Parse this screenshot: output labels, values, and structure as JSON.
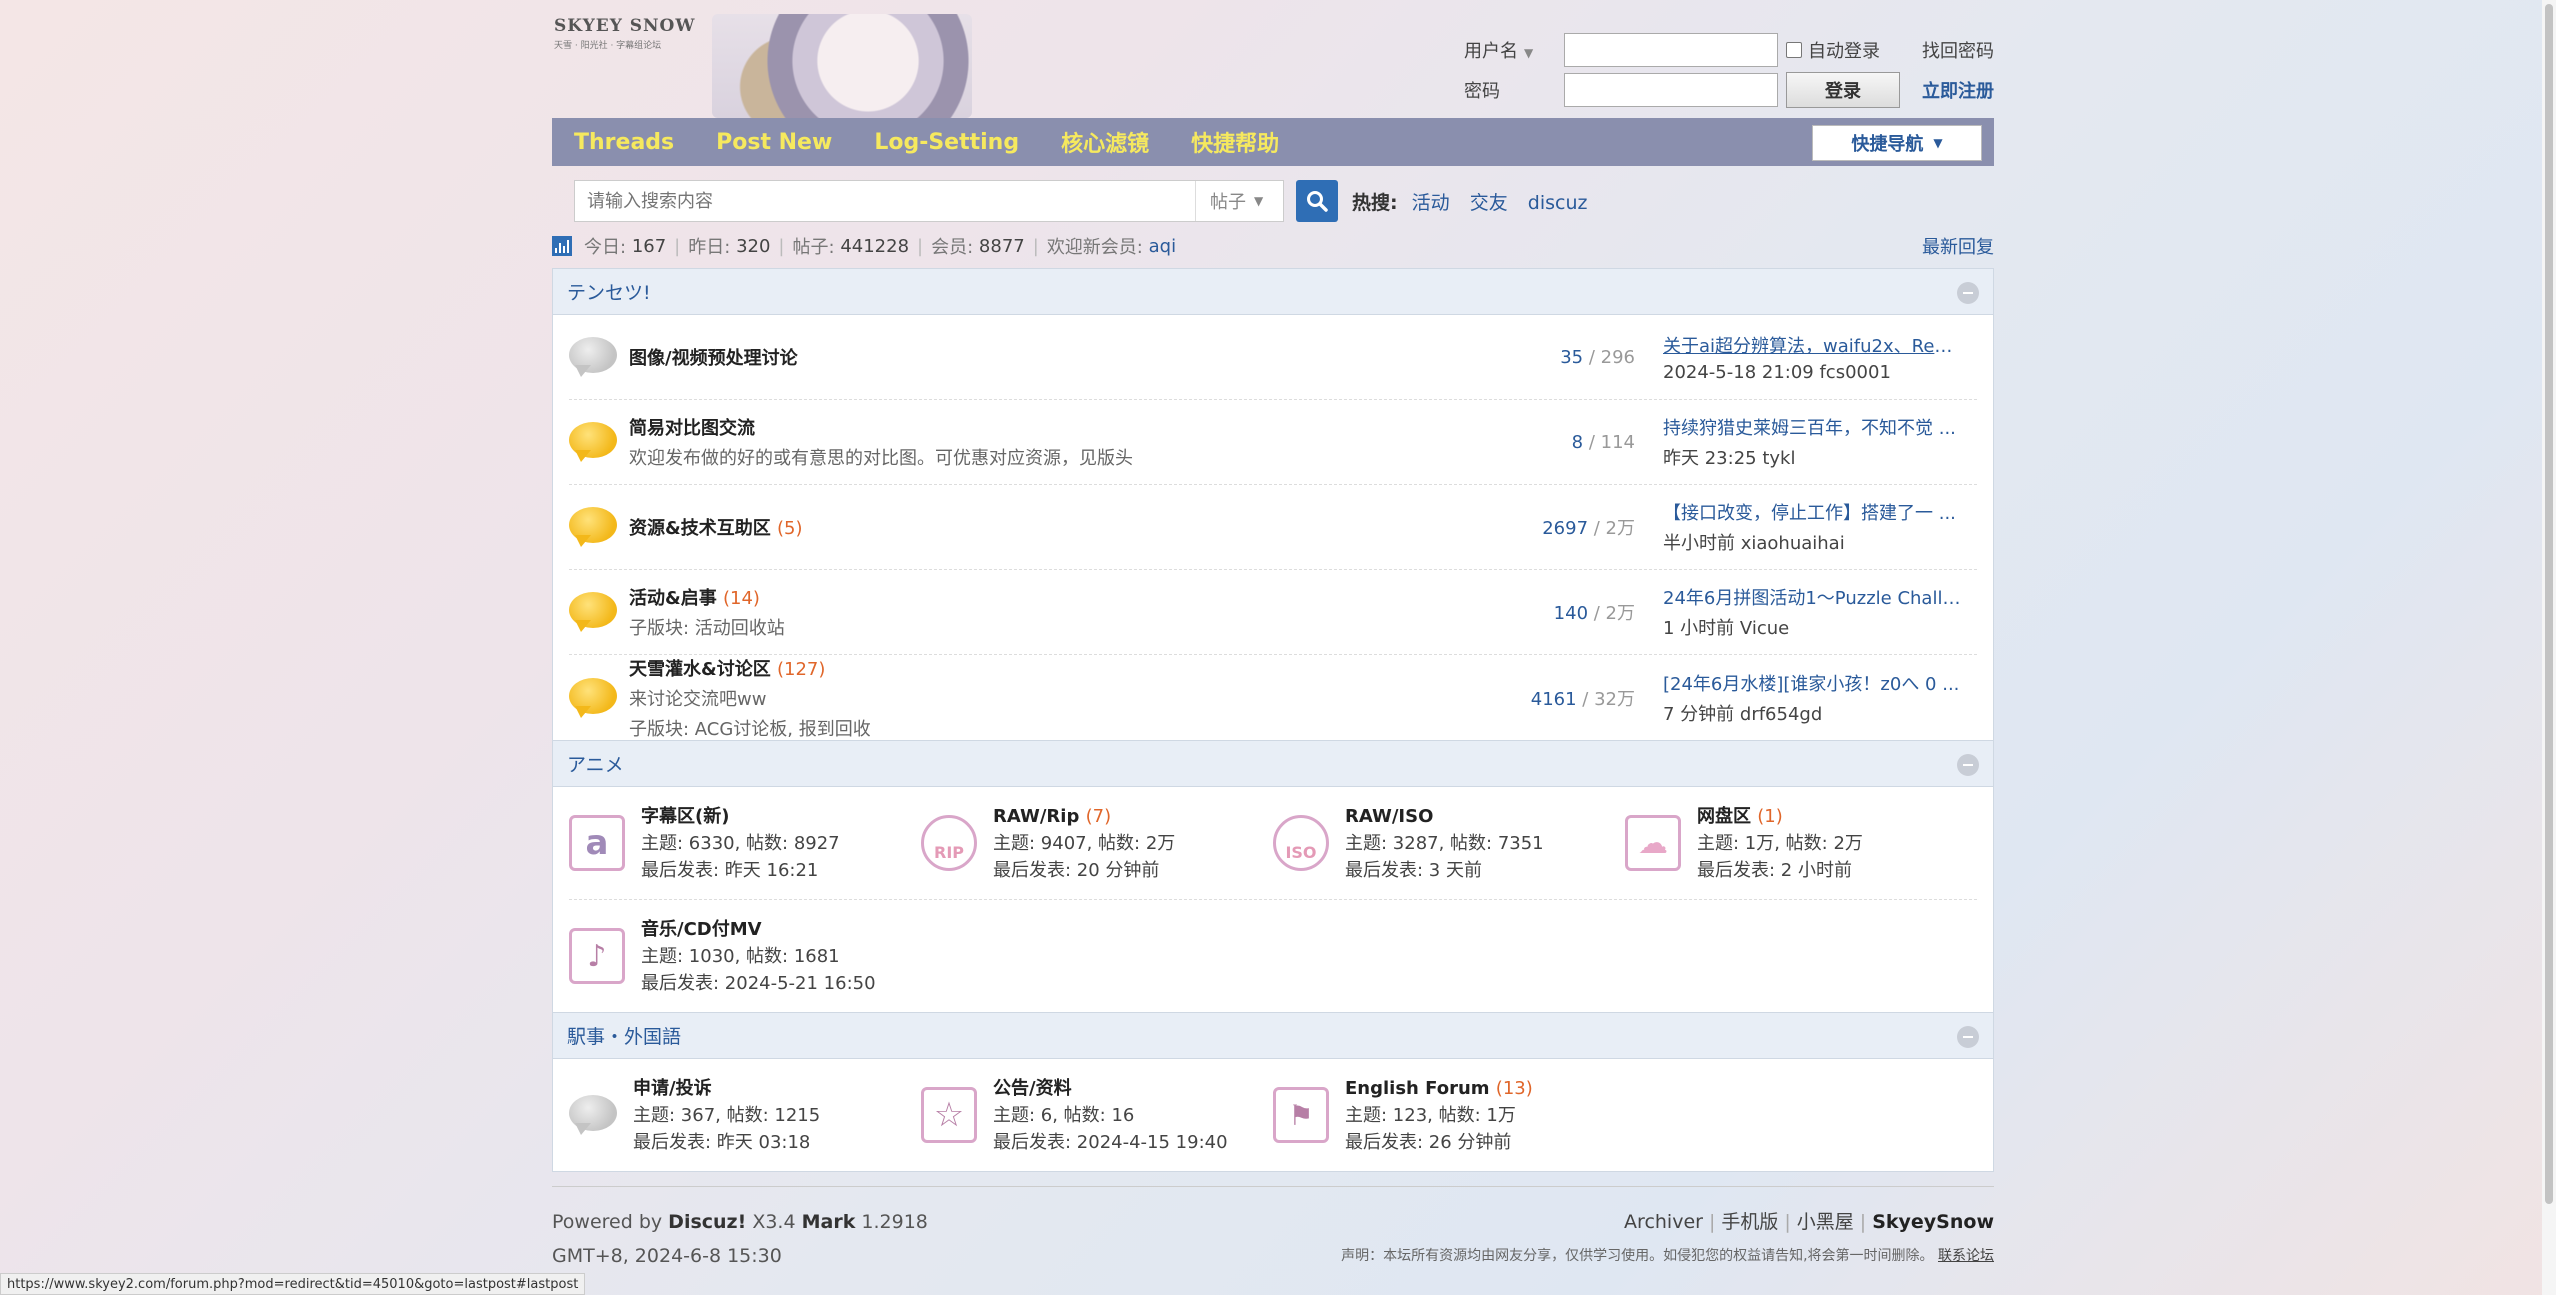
{
  "header": {
    "logo_text": "SKYEY SNOW",
    "logo_sub": "天雪 · 阳光社 · 字幕组论坛",
    "login": {
      "username_label": "用户名",
      "password_label": "密码",
      "auto_login_label": "自动登录",
      "forgot_label": "找回密码",
      "login_button": "登录",
      "register_label": "立即注册"
    }
  },
  "nav": {
    "items": [
      "Threads",
      "Post New",
      "Log-Setting",
      "核心滤镜",
      "快捷帮助"
    ],
    "quick_nav": "快捷导航"
  },
  "search": {
    "placeholder": "请输入搜索内容",
    "type": "帖子",
    "hot_label": "热搜:",
    "hot_items": [
      "活动",
      "交友",
      "discuz"
    ]
  },
  "stats": {
    "today_label": "今日:",
    "today": "167",
    "yesterday_label": "昨日:",
    "yesterday": "320",
    "posts_label": "帖子:",
    "posts": "441228",
    "members_label": "会员:",
    "members": "8877",
    "welcome_label": "欢迎新会员:",
    "welcome_user": "aqi",
    "latest_label": "最新回复"
  },
  "categories": [
    {
      "title": "テンセツ!",
      "forums": [
        {
          "name": "图像/视频预处理讨论",
          "count": "",
          "desc": "",
          "desc2": "",
          "threads": "35",
          "posts": "296",
          "last_title": "关于ai超分辨算法，waifu2x、Rea ...",
          "last_meta": "2024-5-18 21:09 fcs0001",
          "icon": "grey"
        },
        {
          "name": "简易对比图交流",
          "count": "",
          "desc": "欢迎发布做的好的或有意思的对比图。可优惠对应资源，见版头",
          "desc2": "",
          "threads": "8",
          "posts": "114",
          "last_title": "持续狩猎史莱姆三百年，不知不觉 ...",
          "last_meta": "昨天 23:25 tykl",
          "icon": "yellow"
        },
        {
          "name": "资源&技术互助区",
          "count": "(5)",
          "desc": "",
          "desc2": "",
          "threads": "2697",
          "posts": "2万",
          "last_title": "【接口改变，停止工作】搭建了一 ...",
          "last_meta": "半小时前 xiaohuaihai",
          "icon": "yellow"
        },
        {
          "name": "活动&启事",
          "count": "(14)",
          "desc": "子版块: 活动回收站",
          "desc2": "",
          "threads": "140",
          "posts": "2万",
          "last_title": "24年6月拼图活动1～Puzzle Chall ...",
          "last_meta": "1 小时前 Vicue",
          "icon": "yellow"
        },
        {
          "name": "天雪灌水&讨论区",
          "count": "(127)",
          "desc": "来讨论交流吧ww",
          "desc2": "子版块: ACG讨论板, 报到回收",
          "threads": "4161",
          "posts": "32万",
          "last_title": "[24年6月水楼][谁家小孩！z0へ 0 ...",
          "last_meta": "7 分钟前 drf654gd",
          "icon": "yellow"
        }
      ]
    },
    {
      "title": "アニメ",
      "grid": [
        {
          "name": "字幕区(新)",
          "count": "",
          "stats": "主题: 6330, 帖数: 8927",
          "last": "最后发表: 昨天 16:21",
          "icon": "a"
        },
        {
          "name": "RAW/Rip",
          "count": "(7)",
          "stats": "主题: 9407, 帖数: 2万",
          "last": "最后发表: 20 分钟前",
          "icon": "RIP"
        },
        {
          "name": "RAW/ISO",
          "count": "",
          "stats": "主题: 3287, 帖数: 7351",
          "last": "最后发表: 3 天前",
          "icon": "ISO"
        },
        {
          "name": "网盘区",
          "count": "(1)",
          "stats": "主题: 1万, 帖数: 2万",
          "last": "最后发表: 2 小时前",
          "icon": "cloud"
        },
        {
          "name": "音乐/CD付MV",
          "count": "",
          "stats": "主题: 1030, 帖数: 1681",
          "last": "最后发表: 2024-5-21 16:50",
          "icon": "music"
        }
      ]
    },
    {
      "title": "駅事・外国語",
      "grid": [
        {
          "name": "申请/投诉",
          "count": "",
          "stats": "主题: 367, 帖数: 1215",
          "last": "最后发表: 昨天 03:18",
          "icon": "bubble"
        },
        {
          "name": "公告/资料",
          "count": "",
          "stats": "主题: 6, 帖数: 16",
          "last": "最后发表: 2024-4-15 19:40",
          "icon": "star"
        },
        {
          "name": "English Forum",
          "count": "(13)",
          "stats": "主题: 123, 帖数: 1万",
          "last": "最后发表: 26 分钟前",
          "icon": "flag"
        }
      ]
    }
  ],
  "footer": {
    "powered_prefix": "Powered by",
    "discuz": "Discuz!",
    "version": "X3.4",
    "mark": "Mark",
    "mark_version": "1.2918",
    "time": "GMT+8, 2024-6-8 15:30",
    "links": [
      "Archiver",
      "手机版",
      "小黑屋",
      "SkyeySnow"
    ],
    "notice": "声明：本坛所有资源均由网友分享，仅供学习使用。如侵犯您的权益请告知,将会第一时间删除。",
    "contact": "联系论坛"
  },
  "statusbar": "https://www.skyey2.com/forum.php?mod=redirect&tid=45010&goto=lastpost#lastpost",
  "colors": {
    "nav_bg": "#8a8fae",
    "nav_text": "#f6e95e",
    "link": "#2a5a9a",
    "count": "#e0662a",
    "search_btn": "#2f6eb5"
  }
}
